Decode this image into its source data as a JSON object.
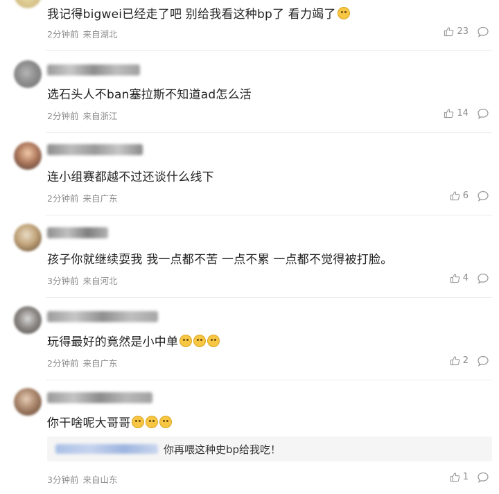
{
  "comments": [
    {
      "text": "我记得bigwei已经走了吧 别给我看这种bp了 看力竭了",
      "time": "2分钟前",
      "location": "来自湖北",
      "likes": "23"
    },
    {
      "text": "选石头人不ban塞拉斯不知道ad怎么活",
      "time": "2分钟前",
      "location": "来自浙江",
      "likes": "14"
    },
    {
      "text": "连小组赛都越不过还谈什么线下",
      "time": "2分钟前",
      "location": "来自广东",
      "likes": "6"
    },
    {
      "text": "孩子你就继续耍我 我一点都不苦 一点不累 一点都不觉得被打脸。",
      "time": "3分钟前",
      "location": "来自河北",
      "likes": "4"
    },
    {
      "text": "玩得最好的竟然是小中单",
      "time": "2分钟前",
      "location": "来自广东",
      "likes": "2"
    },
    {
      "text": "你干啥呢大哥哥",
      "time": "3分钟前",
      "location": "来自山东",
      "likes": "1",
      "reply": {
        "text": "你再喂这种史bp给我吃！"
      }
    }
  ],
  "icons": {
    "like": "thumbs-up-icon",
    "reply": "comment-bubble-icon",
    "emoji": "emoji-icon"
  }
}
